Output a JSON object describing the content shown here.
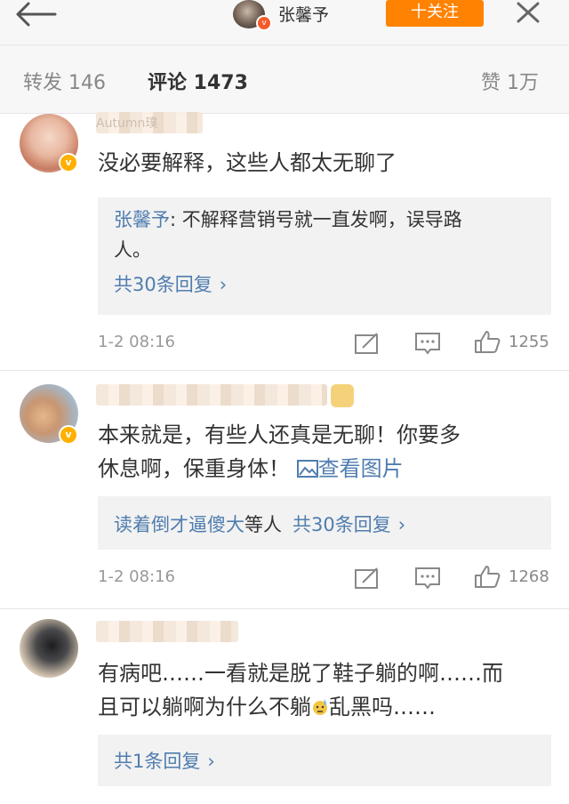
{
  "header": {
    "title": "张馨予",
    "follow_label": "十关注",
    "back_icon": "back-arrow-icon",
    "more_icon": "close-x-icon"
  },
  "tabs": [
    {
      "label": "转发 146"
    },
    {
      "label": "评论 1473"
    },
    {
      "label": "赞 1万"
    }
  ],
  "comments": [
    {
      "username_visible": "Autumn璞",
      "text": "没必要解释，这些人都太无聊了",
      "reply": {
        "author": "张馨予",
        "text_line1": "不解释营销号就一直发啊，误导路",
        "text_line2": "人。",
        "more": "共30条回复"
      },
      "time": "1-2 08:16",
      "likes": "1255"
    },
    {
      "text_line1": "本来就是，有些人还真是无聊！你要多",
      "text_line2": "休息啊，保重身体！",
      "view_image": "查看图片",
      "reply": {
        "names": "读着倒才逼傻大",
        "suffix": "等人",
        "more": "共30条回复"
      },
      "time": "1-2 08:16",
      "likes": "1268"
    },
    {
      "text_line1": "有病吧……一看就是脱了鞋子躺的啊……而",
      "text_line2_a": "且可以躺啊为什么不躺",
      "text_line2_b": "乱黑吗……",
      "reply": {
        "more": "共1条回复"
      }
    }
  ],
  "colors": {
    "accent": "#ff8200",
    "link": "#507daf",
    "verified_badge": "#ffb000",
    "header_badge": "#f55a2a"
  }
}
